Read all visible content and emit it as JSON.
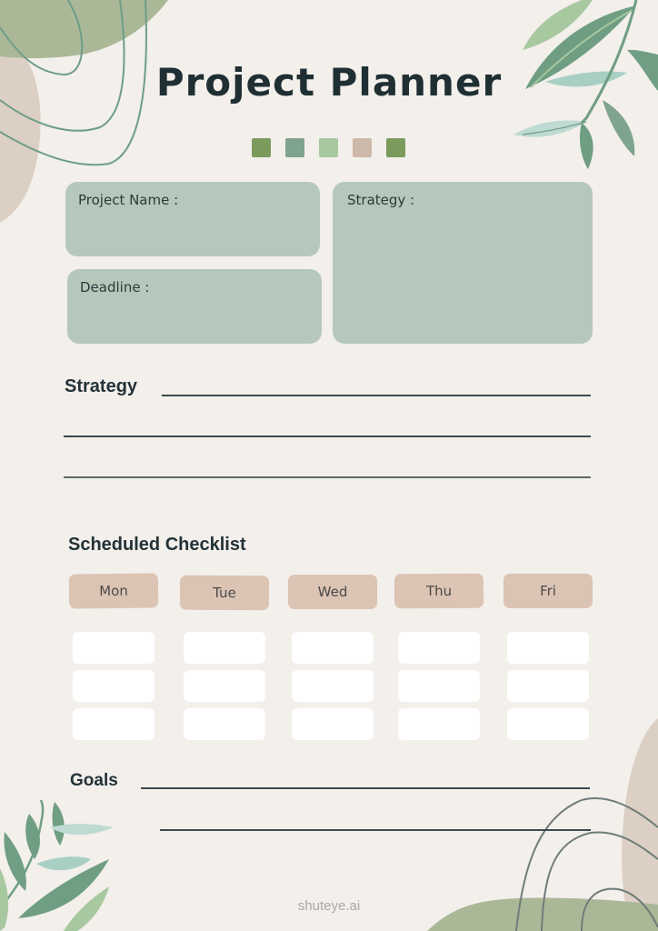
{
  "header": {
    "title": "Project Planner",
    "palette": [
      "#7b9a5c",
      "#7fa48e",
      "#a8c8a0",
      "#cdb9aa",
      "#7b9a5c"
    ]
  },
  "info_boxes": {
    "project_name_label": "Project Name :",
    "deadline_label": "Deadline :",
    "strategy_label": "Strategy :"
  },
  "strategy_section": {
    "title": "Strategy"
  },
  "checklist": {
    "title": "Scheduled Checklist",
    "days": [
      "Mon",
      "Tue",
      "Wed",
      "Thu",
      "Fri"
    ],
    "slots_per_day": 3
  },
  "goals_section": {
    "title": "Goals"
  },
  "footer": {
    "brand": "shuteye.ai"
  },
  "colors": {
    "background": "#f3efeb",
    "box_green": "#b5c8bb",
    "day_tag": "#dcc4b4",
    "slot": "#ffffff",
    "ink": "#233238",
    "leaf_green": "#6f9e83",
    "blob_green": "#aab897",
    "blob_beige": "#dccfc3",
    "line_green": "#6e9e88",
    "line_gray": "#6f7c7a"
  }
}
